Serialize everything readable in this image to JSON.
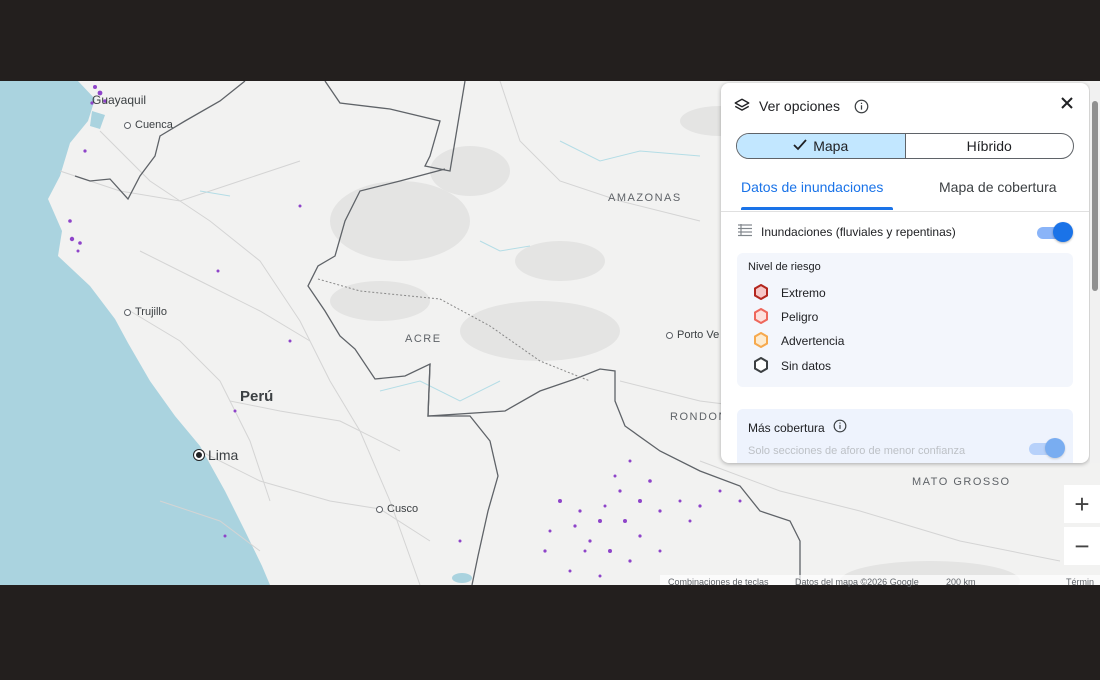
{
  "map": {
    "places": {
      "guayaquil": "Guayaquil",
      "cuenca": "Cuenca",
      "trujillo": "Trujillo",
      "lima": "Lima",
      "cusco": "Cusco",
      "porto_velho": "Porto Ve",
      "peru": "Perú",
      "amazonas": "AMAZONAS",
      "acre": "ACRE",
      "rondonia": "RONDON",
      "mato_grosso": "MATO GROSSO"
    },
    "colors": {
      "ocean": "#aad3df",
      "land": "#f2f2f1",
      "border": "#5f6368",
      "flood": "#8e44c9"
    },
    "attribution": {
      "shortcuts": "Combinaciones de teclas",
      "data": "Datos del mapa ©2026 Google",
      "scale": "200 km",
      "terms": "Términ"
    }
  },
  "panel": {
    "title": "Ver opciones",
    "view_toggle": {
      "map": "Mapa",
      "hybrid": "Híbrido",
      "selected": "Mapa"
    },
    "tabs": [
      {
        "label": "Datos de inundaciones",
        "active": true
      },
      {
        "label": "Mapa de cobertura",
        "active": false
      }
    ],
    "layer": {
      "label": "Inundaciones (fluviales y repentinas)",
      "enabled": true
    },
    "legend": {
      "title": "Nivel de riesgo",
      "items": [
        {
          "label": "Extremo",
          "color": "#b3261e",
          "fill": "#f6c6c6"
        },
        {
          "label": "Peligro",
          "color": "#ee675c",
          "fill": "#fde0dc"
        },
        {
          "label": "Advertencia",
          "color": "#f6a94e",
          "fill": "#fdebd0"
        },
        {
          "label": "Sin datos",
          "color": "#3c4043",
          "fill": "#ffffff"
        }
      ]
    },
    "more": {
      "title": "Más cobertura",
      "subtitle": "Solo secciones de aforo de menor confianza"
    }
  },
  "zoom": {
    "in": "+",
    "out": "−"
  }
}
